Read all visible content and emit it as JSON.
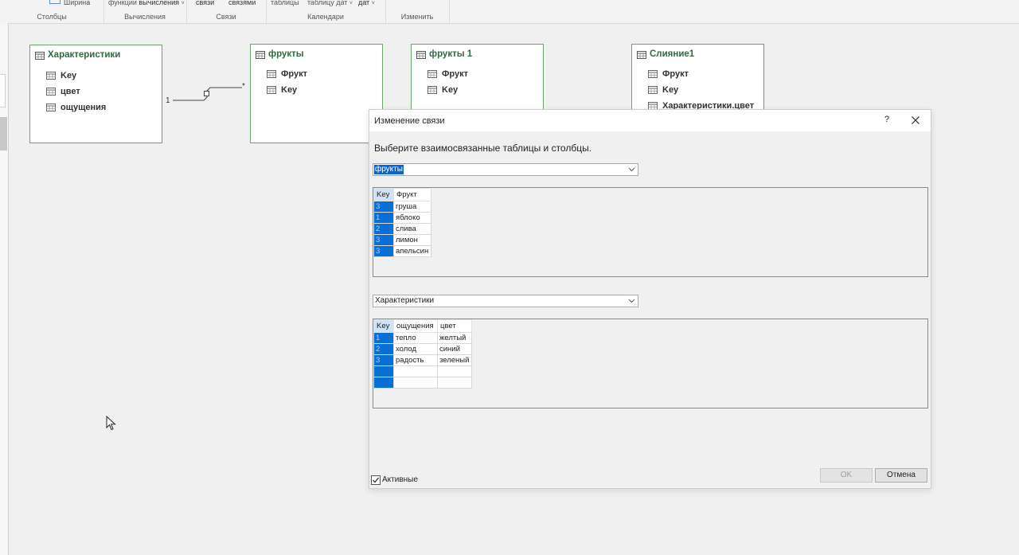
{
  "ribbon": {
    "groups": [
      {
        "top": "Ширина",
        "label": "Столбцы"
      },
      {
        "top_a": "функции",
        "top_b": "вычисления",
        "label": "Вычисления"
      },
      {
        "top_a": "связи",
        "top_b": "связями",
        "label": "Связи"
      },
      {
        "top_a": "таблицы",
        "top_b": "таблицу дат",
        "top_c": "дат",
        "label": "Календари"
      },
      {
        "label": "Изменить"
      }
    ]
  },
  "diagram": {
    "tables": [
      {
        "title": "Характеристики",
        "fields": [
          "Key",
          "цвет",
          "ощущения"
        ]
      },
      {
        "title": "фрукты",
        "fields": [
          "Фрукт",
          "Key"
        ]
      },
      {
        "title": "фрукты 1",
        "fields": [
          "Фрукт",
          "Key"
        ]
      },
      {
        "title": "Слияние1",
        "fields": [
          "Фрукт",
          "Key",
          "Характеристики.цвет"
        ]
      }
    ],
    "relationship": {
      "one": "1",
      "many": "*"
    }
  },
  "dialog": {
    "title": "Изменение связи",
    "help": "?",
    "instruction": "Выберите взаимосвязанные таблицы и столбцы.",
    "table1": {
      "selected": "фрукты",
      "columns": [
        "Key",
        "Фрукт"
      ],
      "rows": [
        [
          "3",
          "груша"
        ],
        [
          "1",
          "яблоко"
        ],
        [
          "2",
          "слива"
        ],
        [
          "3",
          "лимон"
        ],
        [
          "3",
          "апельсин"
        ]
      ]
    },
    "table2": {
      "selected": "Характеристики",
      "columns": [
        "Key",
        "ощущения",
        "цвет"
      ],
      "rows": [
        [
          "1",
          "тепло",
          "желтый"
        ],
        [
          "2",
          "холод",
          "синий"
        ],
        [
          "3",
          "радость",
          "зеленый"
        ],
        [
          "",
          "",
          ""
        ],
        [
          "",
          "",
          ""
        ]
      ]
    },
    "active_label": "Активные",
    "active_checked": true,
    "ok_label": "OK",
    "cancel_label": "Отмена"
  },
  "colors": {
    "table_title": "#2f6a3f",
    "card_border": "#6fa26f",
    "selection": "#0a64d8",
    "key_column": "#0a6fd4"
  }
}
